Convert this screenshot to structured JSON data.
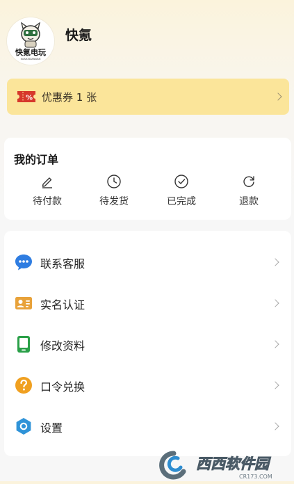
{
  "profile": {
    "username": "快氪",
    "avatar_logo_text": "快氪电玩",
    "avatar_logo_subtext": "KUAIKEDIANWAN",
    "avatar_icon": "cartoon-mascot-avatar"
  },
  "coupon": {
    "label": "优惠券 1 张",
    "icon": "ticket-icon",
    "icon_mark": "%",
    "bg_color": "#fbe59a",
    "icon_color": "#d6382b"
  },
  "orders": {
    "title": "我的订单",
    "items": [
      {
        "label": "待付款",
        "icon": "pencil-icon"
      },
      {
        "label": "待发货",
        "icon": "clock-icon"
      },
      {
        "label": "已完成",
        "icon": "check-circle-icon"
      },
      {
        "label": "退款",
        "icon": "refresh-icon"
      }
    ]
  },
  "menu": {
    "items": [
      {
        "label": "联系客服",
        "icon": "chat-bubble-icon",
        "color": "#2f7de1"
      },
      {
        "label": "实名认证",
        "icon": "id-card-icon",
        "color": "#e8a23a"
      },
      {
        "label": "修改资料",
        "icon": "tablet-icon",
        "color": "#2aa048"
      },
      {
        "label": "口令兑换",
        "icon": "question-icon",
        "color": "#f0a020"
      },
      {
        "label": "设置",
        "icon": "settings-hexagon-icon",
        "color": "#2f93d8"
      }
    ]
  },
  "watermark": {
    "text": "西西软件园",
    "subtext": "CR173.COM"
  }
}
